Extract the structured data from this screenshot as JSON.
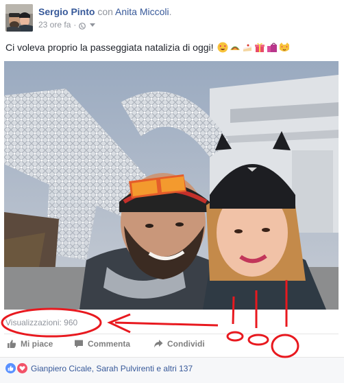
{
  "post": {
    "author": "Sergio Pinto",
    "with_word": "con",
    "tagged": "Anita Miccoli",
    "tagged_suffix": ".",
    "timestamp": "23 ore fa",
    "privacy_icon": "globe-icon",
    "caption": "Ci voleva proprio la passeggiata natalizia di oggi!",
    "caption_emojis": [
      "heart-eyes-emoji",
      "taco-emoji",
      "cake-slice-emoji",
      "gift-emoji",
      "shopping-bags-emoji",
      "heart-eyes-cat-emoji"
    ]
  },
  "stats": {
    "views": "Visualizzazioni: 960"
  },
  "actions": {
    "like": "Mi piace",
    "comment": "Commenta",
    "share": "Condividi"
  },
  "reactions": {
    "icons": [
      "like-reaction-icon",
      "love-reaction-icon"
    ],
    "text": "Gianpiero Cicale, Sarah Pulvirenti e altri 137"
  },
  "colors": {
    "link": "#365899",
    "meta_grey": "#90949c",
    "annotation_red": "#e8191f",
    "like_blue": "#5890ff",
    "love_red": "#f25268"
  }
}
